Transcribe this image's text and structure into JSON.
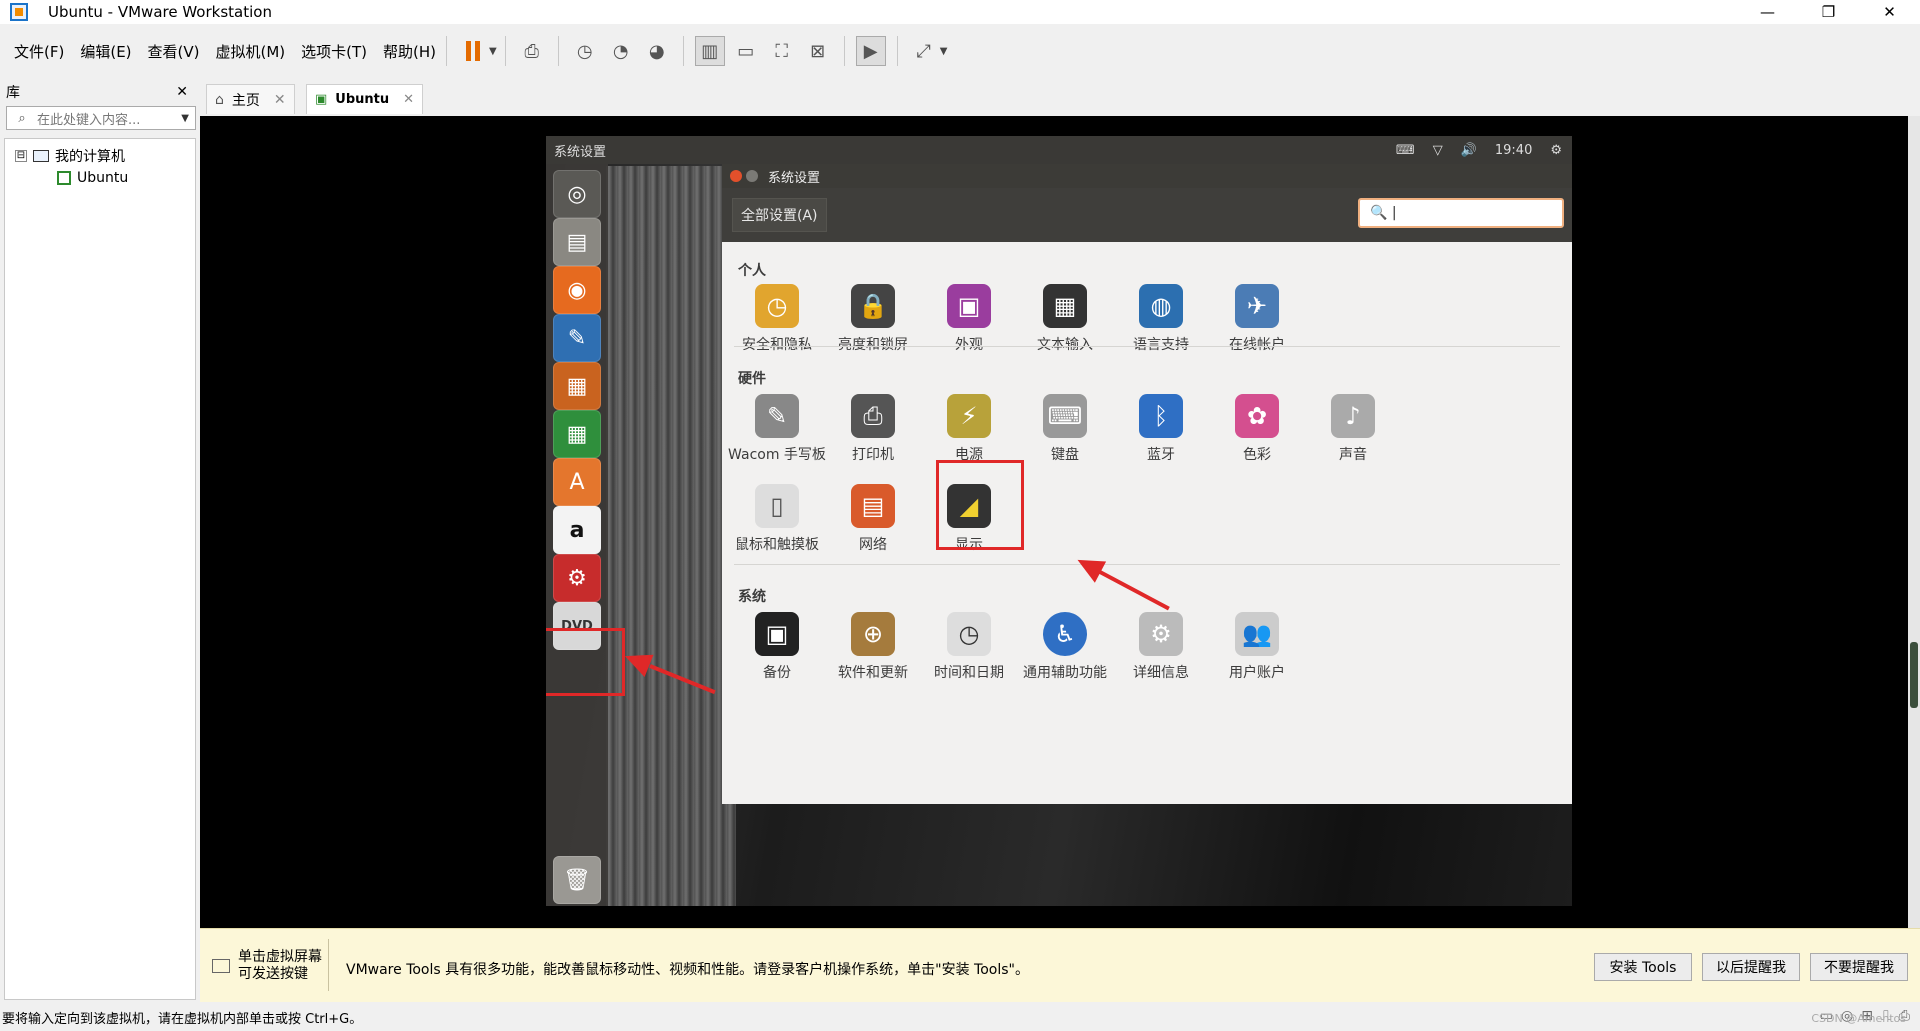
{
  "window": {
    "title": "Ubuntu - VMware Workstation",
    "min": "—",
    "max": "❐",
    "close": "✕"
  },
  "menu": [
    "文件(F)",
    "编辑(E)",
    "查看(V)",
    "虚拟机(M)",
    "选项卡(T)",
    "帮助(H)"
  ],
  "library": {
    "title": "库",
    "close": "✕",
    "search_placeholder": "在此处键入内容...",
    "tree": {
      "root": "我的计算机",
      "child": "Ubuntu",
      "toggle": "⊟"
    }
  },
  "tabs": [
    {
      "label": "主页",
      "close": "✕"
    },
    {
      "label": "Ubuntu",
      "close": "✕"
    }
  ],
  "guest": {
    "topbar": {
      "title": "系统设置",
      "time": "19:40",
      "keyboard": "⌨",
      "wifi": "▽",
      "sound": "🔊",
      "gear": "⚙"
    },
    "dialog": {
      "title": "系统设置",
      "all_settings": "全部设置(A)",
      "search_cursor": "🔍 |",
      "sections": {
        "personal": {
          "label": "个人",
          "items": [
            "安全和隐私",
            "亮度和锁屏",
            "外观",
            "文本输入",
            "语言支持",
            "在线帐户"
          ]
        },
        "hardware": {
          "label": "硬件",
          "items": [
            "Wacom 手写板",
            "打印机",
            "电源",
            "键盘",
            "蓝牙",
            "色彩",
            "声音",
            "鼠标和触摸板",
            "网络",
            "显示"
          ]
        },
        "system": {
          "label": "系统",
          "items": [
            "备份",
            "软件和更新",
            "时间和日期",
            "通用辅助功能",
            "详细信息",
            "用户账户"
          ]
        }
      }
    }
  },
  "notification": {
    "left_line1": "单击虚拟屏幕",
    "left_line2": "可发送按键",
    "message": "VMware Tools 具有很多功能，能改善鼠标移动性、视频和性能。请登录客户机操作系统，单击\"安装 Tools\"。",
    "buttons": [
      "安装 Tools",
      "以后提醒我",
      "不要提醒我"
    ]
  },
  "status": {
    "message": "要将输入定向到该虚拟机，请在虚拟机内部单击或按 Ctrl+G。",
    "watermark": "CSDN @Amentos"
  },
  "colors": {
    "accent_red": "#e02828",
    "pause_orange": "#e46b00",
    "notify_bg": "#fcf7d8"
  }
}
